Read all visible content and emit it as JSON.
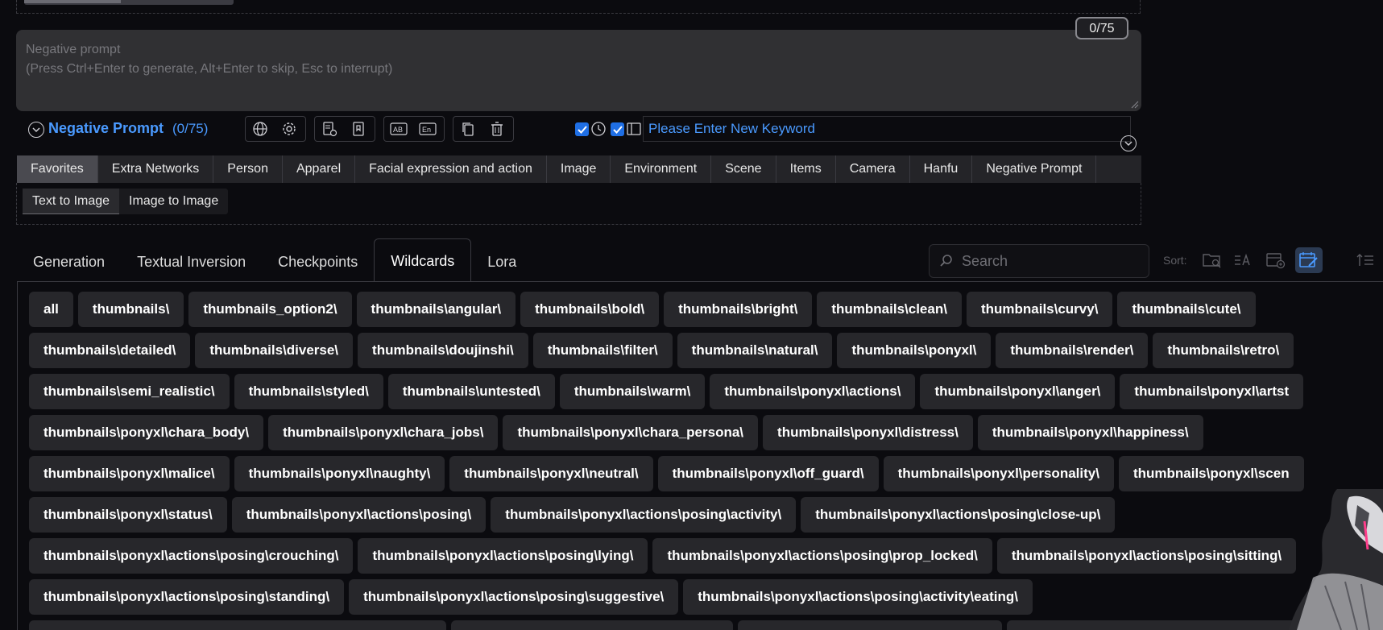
{
  "prompt_counter": "0/75",
  "negative_prompt": {
    "placeholder_line1": "Negative prompt",
    "placeholder_line2": "(Press Ctrl+Enter to generate, Alt+Enter to skip, Esc to interrupt)"
  },
  "toolbar": {
    "title": "Negative Prompt",
    "count": "(0/75)",
    "keyword_placeholder": "Please Enter New Keyword"
  },
  "category_tabs": [
    {
      "label": "Favorites"
    },
    {
      "label": "Extra Networks"
    },
    {
      "label": "Person"
    },
    {
      "label": "Apparel"
    },
    {
      "label": "Facial expression and action"
    },
    {
      "label": "Image"
    },
    {
      "label": "Environment"
    },
    {
      "label": "Scene"
    },
    {
      "label": "Items"
    },
    {
      "label": "Camera"
    },
    {
      "label": "Hanfu"
    },
    {
      "label": "Negative Prompt"
    }
  ],
  "sub_tabs": [
    {
      "label": "Text to Image"
    },
    {
      "label": "Image to Image"
    }
  ],
  "main_tabs": [
    {
      "label": "Generation"
    },
    {
      "label": "Textual Inversion"
    },
    {
      "label": "Checkpoints"
    },
    {
      "label": "Wildcards"
    },
    {
      "label": "Lora"
    }
  ],
  "search": {
    "placeholder": "Search"
  },
  "sort": {
    "label": "Sort:"
  },
  "chip_rows": [
    [
      "all",
      "thumbnails\\",
      "thumbnails_option2\\",
      "thumbnails\\angular\\",
      "thumbnails\\bold\\",
      "thumbnails\\bright\\",
      "thumbnails\\clean\\",
      "thumbnails\\curvy\\",
      "thumbnails\\cute\\"
    ],
    [
      "thumbnails\\detailed\\",
      "thumbnails\\diverse\\",
      "thumbnails\\doujinshi\\",
      "thumbnails\\filter\\",
      "thumbnails\\natural\\",
      "thumbnails\\ponyxl\\",
      "thumbnails\\render\\",
      "thumbnails\\retro\\"
    ],
    [
      "thumbnails\\semi_realistic\\",
      "thumbnails\\styled\\",
      "thumbnails\\untested\\",
      "thumbnails\\warm\\",
      "thumbnails\\ponyxl\\actions\\",
      "thumbnails\\ponyxl\\anger\\",
      "thumbnails\\ponyxl\\artst"
    ],
    [
      "thumbnails\\ponyxl\\chara_body\\",
      "thumbnails\\ponyxl\\chara_jobs\\",
      "thumbnails\\ponyxl\\chara_persona\\",
      "thumbnails\\ponyxl\\distress\\",
      "thumbnails\\ponyxl\\happiness\\"
    ],
    [
      "thumbnails\\ponyxl\\malice\\",
      "thumbnails\\ponyxl\\naughty\\",
      "thumbnails\\ponyxl\\neutral\\",
      "thumbnails\\ponyxl\\off_guard\\",
      "thumbnails\\ponyxl\\personality\\",
      "thumbnails\\ponyxl\\scen"
    ],
    [
      "thumbnails\\ponyxl\\status\\",
      "thumbnails\\ponyxl\\actions\\posing\\",
      "thumbnails\\ponyxl\\actions\\posing\\activity\\",
      "thumbnails\\ponyxl\\actions\\posing\\close-up\\"
    ],
    [
      "thumbnails\\ponyxl\\actions\\posing\\crouching\\",
      "thumbnails\\ponyxl\\actions\\posing\\lying\\",
      "thumbnails\\ponyxl\\actions\\posing\\prop_locked\\",
      "thumbnails\\ponyxl\\actions\\posing\\sitting\\"
    ],
    [
      "thumbnails\\ponyxl\\actions\\posing\\standing\\",
      "thumbnails\\ponyxl\\actions\\posing\\suggestive\\",
      "thumbnails\\ponyxl\\actions\\posing\\activity\\eating\\"
    ]
  ]
}
